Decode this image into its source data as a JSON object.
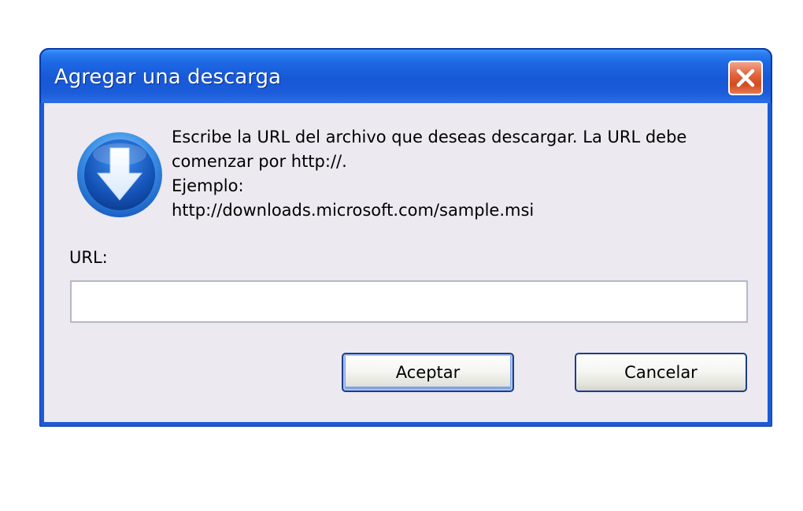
{
  "dialog": {
    "title": "Agregar una descarga",
    "close_icon": "close-icon",
    "icon": "download-arrow-icon",
    "message_lines": [
      "Escribe la URL del archivo que deseas descargar. La URL debe",
      "comenzar por http://.",
      "Ejemplo:",
      "http://downloads.microsoft.com/sample.msi"
    ],
    "url_label": "URL:",
    "url_value": "",
    "accept_label": "Aceptar",
    "cancel_label": "Cancelar"
  },
  "colors": {
    "titlebar": "#1758d6",
    "client_background": "#ece9f0",
    "close_button": "#e2643c",
    "button_border": "#1c3e8a"
  }
}
